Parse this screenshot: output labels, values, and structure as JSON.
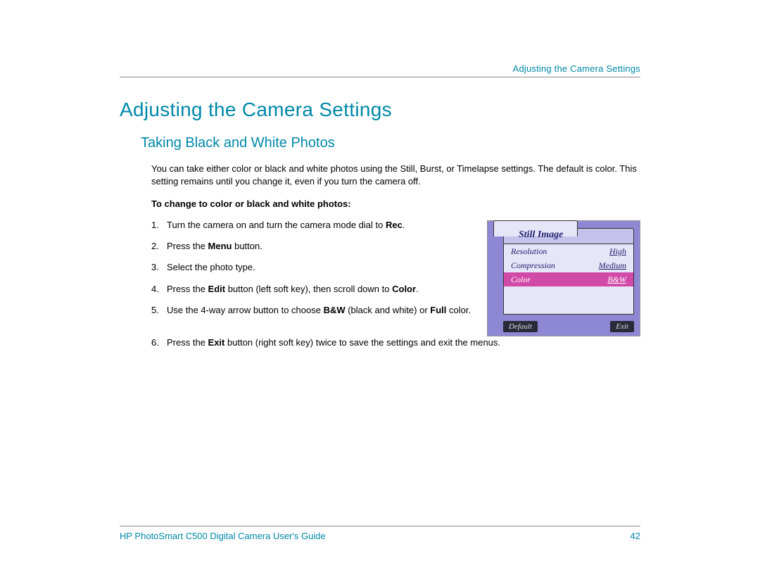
{
  "header": {
    "top_right": "Adjusting the Camera Settings"
  },
  "title": "Adjusting the Camera Settings",
  "section_title": "Taking Black and White Photos",
  "intro": "You can take either color or black and white photos using the Still, Burst, or Timelapse settings. The default is color. This setting remains until you change it, even if you turn the camera off.",
  "subheading": "To change to color or black and white photos:",
  "steps": [
    {
      "n": "1.",
      "pre": "Turn the camera on and turn the camera mode dial to ",
      "b1": "Rec",
      "post": "."
    },
    {
      "n": "2.",
      "pre": "Press the ",
      "b1": "Menu",
      "post": " button."
    },
    {
      "n": "3.",
      "pre": "Select the photo type.",
      "b1": "",
      "post": ""
    },
    {
      "n": "4.",
      "pre": "Press the ",
      "b1": "Edit",
      "mid": " button (left soft key), then scroll down to ",
      "b2": "Color",
      "post": "."
    },
    {
      "n": "5.",
      "pre": "Use the 4-way arrow button to choose ",
      "b1": "B&W",
      "mid": " (black and white) or ",
      "b2": "Full",
      "post": " color."
    },
    {
      "n": "6.",
      "pre": "Press the ",
      "b1": "Exit",
      "post": " button (right soft key) twice to save the settings and exit the menus."
    }
  ],
  "lcd": {
    "title": "Still Image",
    "rows": [
      {
        "label": "Resolution",
        "value": "High"
      },
      {
        "label": "Compression",
        "value": "Medium"
      },
      {
        "label": "Color",
        "value": "B&W",
        "selected": true
      }
    ],
    "left_btn": "Default",
    "right_btn": "Exit"
  },
  "footer": {
    "left": "HP PhotoSmart C500 Digital Camera User's Guide",
    "right": "42"
  }
}
